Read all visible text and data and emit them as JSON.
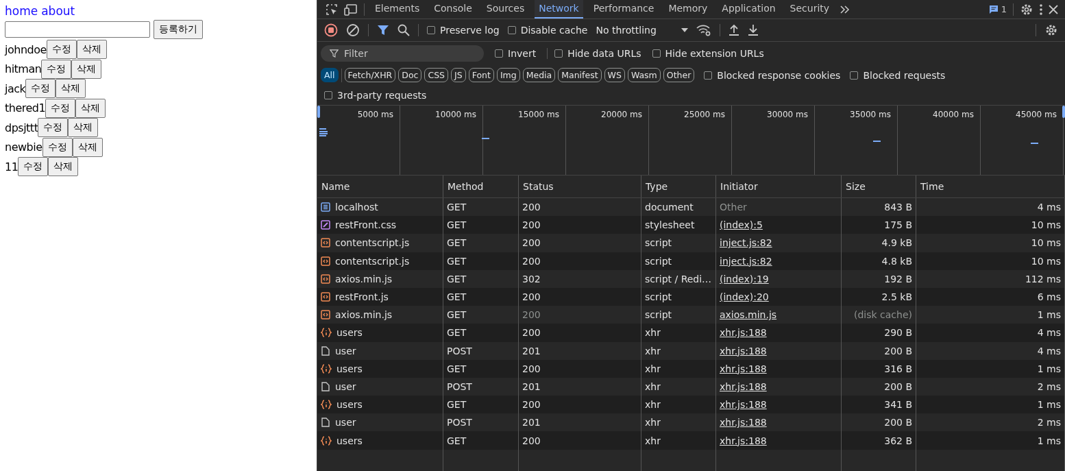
{
  "page": {
    "nav_links": [
      "home",
      "about"
    ],
    "register_button": "등록하기",
    "users": [
      {
        "name": "johndoe",
        "edit": "수정",
        "delete": "삭제"
      },
      {
        "name": "hitman",
        "edit": "수정",
        "delete": "삭제"
      },
      {
        "name": "jack",
        "edit": "수정",
        "delete": "삭제"
      },
      {
        "name": "thered1",
        "edit": "수정",
        "delete": "삭제"
      },
      {
        "name": "dpsjttt",
        "edit": "수정",
        "delete": "삭제"
      },
      {
        "name": "newbie",
        "edit": "수정",
        "delete": "삭제"
      },
      {
        "name": "11",
        "edit": "수정",
        "delete": "삭제"
      }
    ]
  },
  "devtools": {
    "tabs": [
      {
        "label": "Elements",
        "selected": false
      },
      {
        "label": "Console",
        "selected": false
      },
      {
        "label": "Sources",
        "selected": false
      },
      {
        "label": "Network",
        "selected": true
      },
      {
        "label": "Performance",
        "selected": false
      },
      {
        "label": "Memory",
        "selected": false
      },
      {
        "label": "Application",
        "selected": false
      },
      {
        "label": "Security",
        "selected": false
      }
    ],
    "issues_count": "1",
    "toolbar": {
      "checkboxes": [
        {
          "label": "Preserve log",
          "checked": false
        },
        {
          "label": "Disable cache",
          "checked": false
        }
      ],
      "throttling": "No throttling"
    },
    "filter": {
      "placeholder": "Filter",
      "checkboxes": [
        {
          "label": "Invert",
          "checked": false
        },
        {
          "label": "Hide data URLs",
          "checked": false
        },
        {
          "label": "Hide extension URLs",
          "checked": false
        }
      ]
    },
    "type_filters": [
      {
        "label": "All",
        "selected": true
      },
      {
        "label": "Fetch/XHR",
        "selected": false
      },
      {
        "label": "Doc",
        "selected": false
      },
      {
        "label": "CSS",
        "selected": false
      },
      {
        "label": "JS",
        "selected": false
      },
      {
        "label": "Font",
        "selected": false
      },
      {
        "label": "Img",
        "selected": false
      },
      {
        "label": "Media",
        "selected": false
      },
      {
        "label": "Manifest",
        "selected": false
      },
      {
        "label": "WS",
        "selected": false
      },
      {
        "label": "Wasm",
        "selected": false
      },
      {
        "label": "Other",
        "selected": false
      }
    ],
    "type_checkboxes": [
      {
        "label": "Blocked response cookies",
        "checked": false
      },
      {
        "label": "Blocked requests",
        "checked": false
      }
    ],
    "third_party": {
      "label": "3rd-party requests",
      "checked": false
    },
    "timeline_ticks": [
      "5000 ms",
      "10000 ms",
      "15000 ms",
      "20000 ms",
      "25000 ms",
      "30000 ms",
      "35000 ms",
      "40000 ms",
      "45000 ms"
    ],
    "columns": [
      "Name",
      "Method",
      "Status",
      "Type",
      "Initiator",
      "Size",
      "Time"
    ],
    "rows": [
      {
        "kind": "document",
        "name": "localhost",
        "method": "GET",
        "status": "200",
        "status_dimmed": false,
        "type": "document",
        "initiator": "Other",
        "initiator_link": false,
        "size": "843 B",
        "size_dimmed": false,
        "time": "4 ms"
      },
      {
        "kind": "stylesheet",
        "name": "restFront.css",
        "method": "GET",
        "status": "200",
        "status_dimmed": false,
        "type": "stylesheet",
        "initiator": "(index):5",
        "initiator_link": true,
        "size": "175 B",
        "size_dimmed": false,
        "time": "10 ms"
      },
      {
        "kind": "script",
        "name": "contentscript.js",
        "method": "GET",
        "status": "200",
        "status_dimmed": false,
        "type": "script",
        "initiator": "inject.js:82",
        "initiator_link": true,
        "size": "4.9 kB",
        "size_dimmed": false,
        "time": "10 ms"
      },
      {
        "kind": "script",
        "name": "contentscript.js",
        "method": "GET",
        "status": "200",
        "status_dimmed": false,
        "type": "script",
        "initiator": "inject.js:82",
        "initiator_link": true,
        "size": "4.8 kB",
        "size_dimmed": false,
        "time": "10 ms"
      },
      {
        "kind": "script",
        "name": "axios.min.js",
        "method": "GET",
        "status": "302",
        "status_dimmed": false,
        "type": "script / Redi…",
        "initiator": "(index):19",
        "initiator_link": true,
        "size": "192 B",
        "size_dimmed": false,
        "time": "112 ms"
      },
      {
        "kind": "script",
        "name": "restFront.js",
        "method": "GET",
        "status": "200",
        "status_dimmed": false,
        "type": "script",
        "initiator": "(index):20",
        "initiator_link": true,
        "size": "2.5 kB",
        "size_dimmed": false,
        "time": "6 ms"
      },
      {
        "kind": "script",
        "name": "axios.min.js",
        "method": "GET",
        "status": "200",
        "status_dimmed": true,
        "type": "script",
        "initiator": "axios.min.js",
        "initiator_link": true,
        "size": "(disk cache)",
        "size_dimmed": true,
        "time": "1 ms"
      },
      {
        "kind": "xhr",
        "name": "users",
        "method": "GET",
        "status": "200",
        "status_dimmed": false,
        "type": "xhr",
        "initiator": "xhr.js:188",
        "initiator_link": true,
        "size": "290 B",
        "size_dimmed": false,
        "time": "4 ms"
      },
      {
        "kind": "other",
        "name": "user",
        "method": "POST",
        "status": "201",
        "status_dimmed": false,
        "type": "xhr",
        "initiator": "xhr.js:188",
        "initiator_link": true,
        "size": "200 B",
        "size_dimmed": false,
        "time": "4 ms"
      },
      {
        "kind": "xhr",
        "name": "users",
        "method": "GET",
        "status": "200",
        "status_dimmed": false,
        "type": "xhr",
        "initiator": "xhr.js:188",
        "initiator_link": true,
        "size": "316 B",
        "size_dimmed": false,
        "time": "1 ms"
      },
      {
        "kind": "other",
        "name": "user",
        "method": "POST",
        "status": "201",
        "status_dimmed": false,
        "type": "xhr",
        "initiator": "xhr.js:188",
        "initiator_link": true,
        "size": "200 B",
        "size_dimmed": false,
        "time": "2 ms"
      },
      {
        "kind": "xhr",
        "name": "users",
        "method": "GET",
        "status": "200",
        "status_dimmed": false,
        "type": "xhr",
        "initiator": "xhr.js:188",
        "initiator_link": true,
        "size": "341 B",
        "size_dimmed": false,
        "time": "1 ms"
      },
      {
        "kind": "other",
        "name": "user",
        "method": "POST",
        "status": "201",
        "status_dimmed": false,
        "type": "xhr",
        "initiator": "xhr.js:188",
        "initiator_link": true,
        "size": "200 B",
        "size_dimmed": false,
        "time": "2 ms"
      },
      {
        "kind": "xhr",
        "name": "users",
        "method": "GET",
        "status": "200",
        "status_dimmed": false,
        "type": "xhr",
        "initiator": "xhr.js:188",
        "initiator_link": true,
        "size": "362 B",
        "size_dimmed": false,
        "time": "1 ms"
      }
    ]
  }
}
